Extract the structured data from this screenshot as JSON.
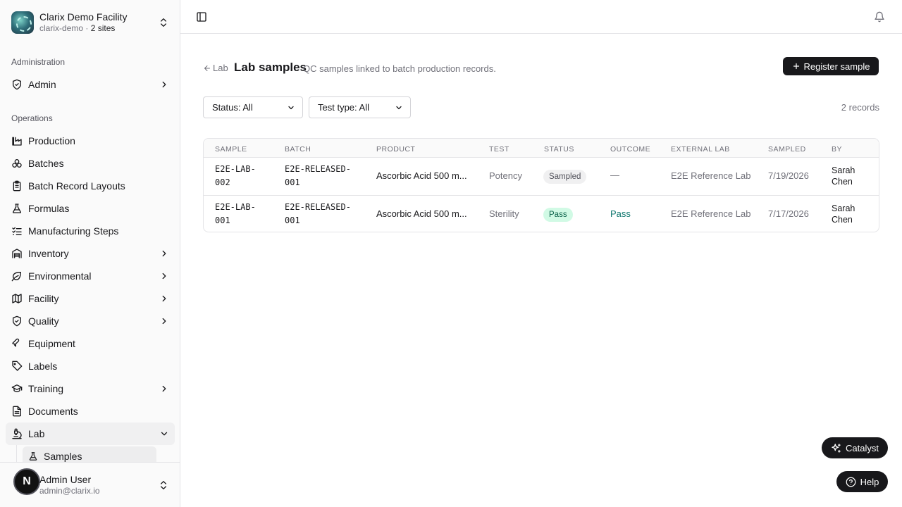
{
  "org": {
    "name": "Clarix Demo Facility",
    "slug": "clarix-demo",
    "sites": "2 sites",
    "separator": "·"
  },
  "sidebar": {
    "groups": {
      "administration": "Administration",
      "operations": "Operations"
    },
    "admin": "Admin",
    "items": [
      "Production",
      "Batches",
      "Batch Record Layouts",
      "Formulas",
      "Manufacturing Steps",
      "Inventory",
      "Environmental",
      "Facility",
      "Quality",
      "Equipment",
      "Labels",
      "Training",
      "Documents",
      "Lab"
    ],
    "lab_sub": "Samples"
  },
  "user": {
    "initial": "N",
    "name": "Admin User",
    "email": "admin@clarix.io"
  },
  "page": {
    "back": "Lab",
    "title": "Lab samples",
    "description": "QC samples linked to batch production records.",
    "register": "Register sample",
    "filter_status": "Status: All",
    "filter_test": "Test type: All",
    "records": "2 records"
  },
  "table": {
    "headers": [
      "SAMPLE",
      "BATCH",
      "PRODUCT",
      "TEST",
      "STATUS",
      "OUTCOME",
      "EXTERNAL LAB",
      "SAMPLED",
      "BY"
    ],
    "rows": [
      {
        "sample_1": "E2E-LAB-",
        "sample_2": "002",
        "batch_1": "E2E-RELEASED-",
        "batch_2": "001",
        "product": "Ascorbic Acid 500 m...",
        "test": "Potency",
        "status": "Sampled",
        "outcome": "—",
        "lab": "E2E Reference Lab",
        "sampled": "7/19/2026",
        "by_1": "Sarah",
        "by_2": "Chen"
      },
      {
        "sample_1": "E2E-LAB-",
        "sample_2": "001",
        "batch_1": "E2E-RELEASED-",
        "batch_2": "001",
        "product": "Ascorbic Acid 500 m...",
        "test": "Sterility",
        "status": "Pass",
        "outcome": "Pass",
        "lab": "E2E Reference Lab",
        "sampled": "7/17/2026",
        "by_1": "Sarah",
        "by_2": "Chen"
      }
    ]
  },
  "fabs": {
    "catalyst": "Catalyst",
    "help": "Help"
  },
  "icons": [
    "chevrons-up-down-icon",
    "shield-check-icon",
    "chevron-right-icon",
    "chevron-down-icon",
    "factory-icon",
    "boxes-icon",
    "clipboard-list-icon",
    "flask-icon",
    "list-checks-icon",
    "warehouse-icon",
    "leaf-icon",
    "map-icon",
    "badge-check-icon",
    "wrench-icon",
    "tag-icon",
    "graduation-cap-icon",
    "file-text-icon",
    "microscope-icon",
    "panel-left-icon",
    "bell-icon",
    "arrow-left-icon",
    "plus-icon",
    "sparkles-icon",
    "help-circle-icon"
  ]
}
